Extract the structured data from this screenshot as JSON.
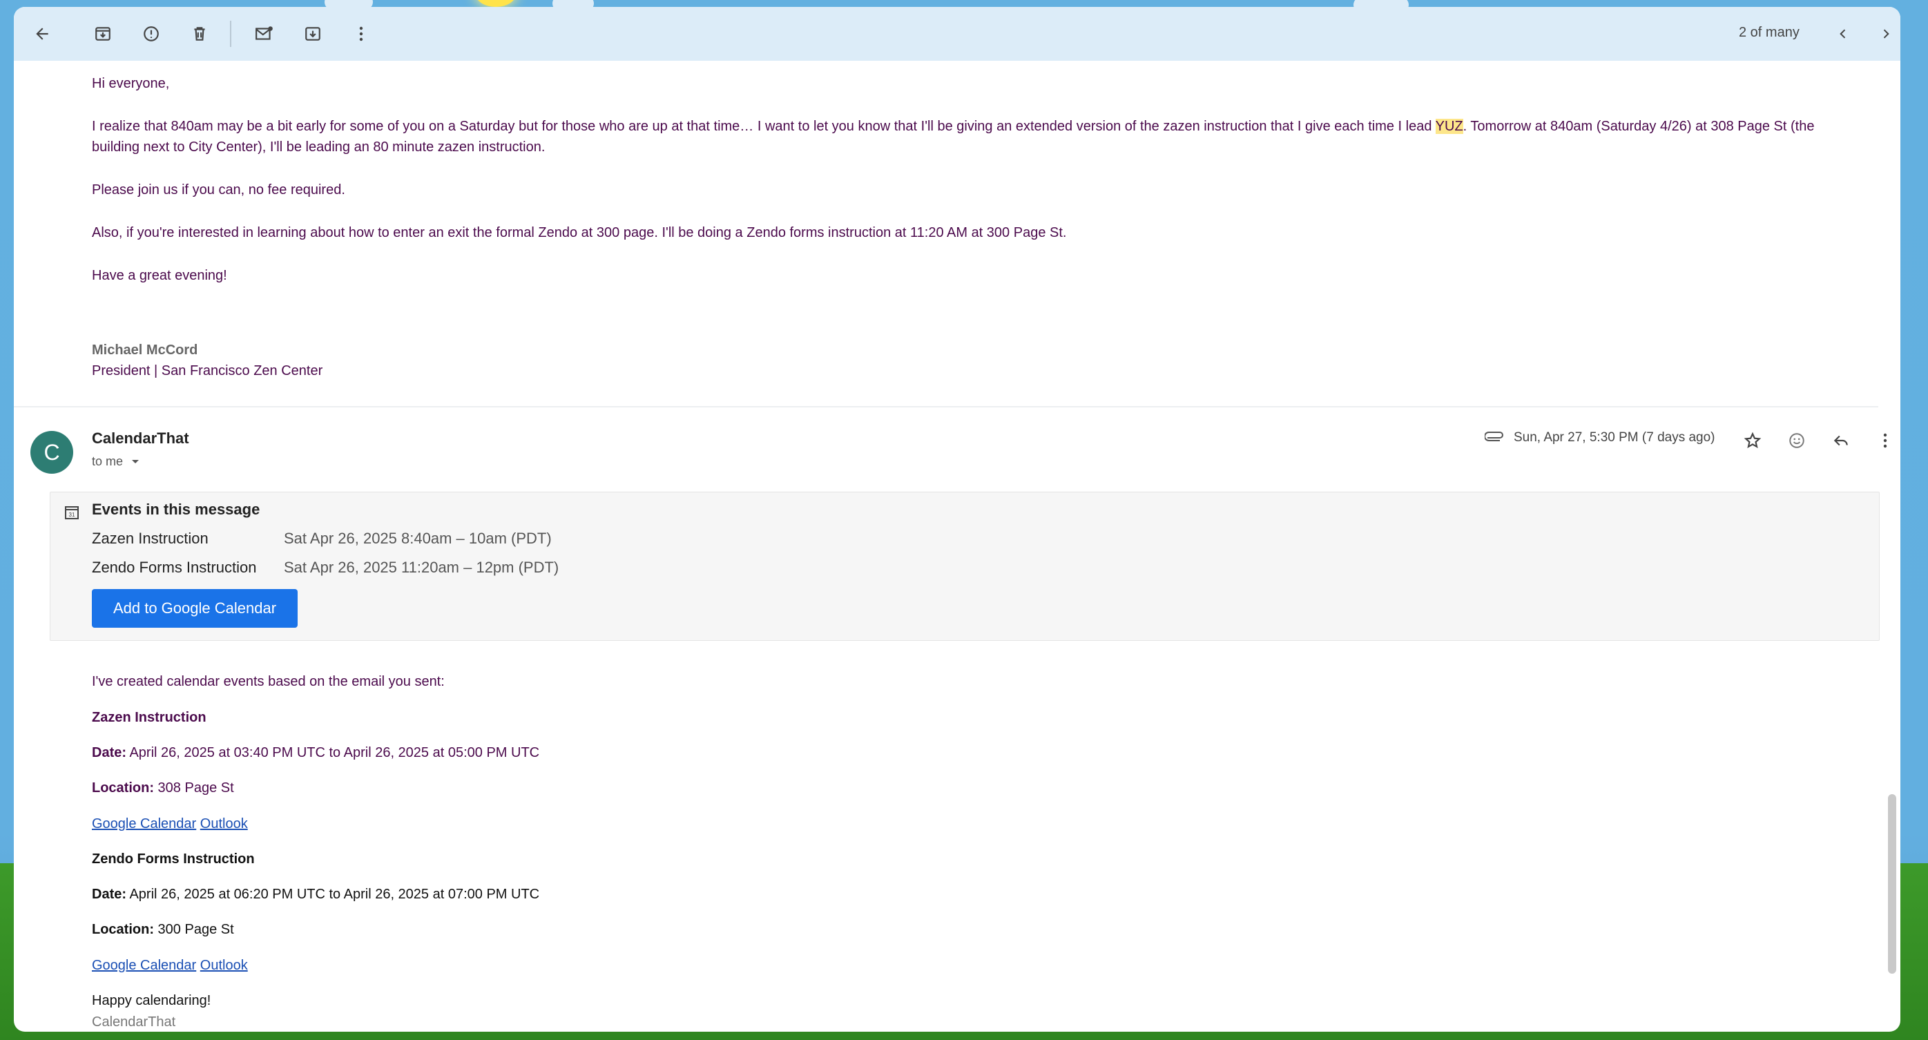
{
  "toolbar": {
    "pager": "2 of many"
  },
  "message1": {
    "greeting": "Hi everyone,",
    "para1_part1": "I realize that 840am may be a bit early for some of you on a Saturday but for those who are up at that time… I want to let you know that I'll be giving an extended version of the zazen instruction that I give each time I lead ",
    "para1_highlight": "YUZ",
    "para1_part2": ". Tomorrow at 840am (Saturday 4/26) at 308 Page St (the",
    "para1_line2": "building next to City Center), I'll be leading an 80 minute zazen instruction.",
    "para2": "Please join us if you can, no fee required.",
    "para3": "Also, if you're interested in learning about how to enter an exit the formal Zendo at 300 page. I'll be doing a Zendo forms instruction at 11:20 AM at 300 Page St.",
    "para4": "Have a great evening!",
    "signature_name": "Michael McCord",
    "signature_title": "President | San Francisco Zen Center"
  },
  "message2": {
    "avatar_letter": "C",
    "sender": "CalendarThat",
    "to": "to me",
    "date": "Sun, Apr 27, 5:30 PM (7 days ago)",
    "events_title": "Events in this message",
    "events": [
      {
        "name": "Zazen Instruction",
        "time": "Sat Apr 26, 2025 8:40am – 10am (PDT)"
      },
      {
        "name": "Zendo Forms Instruction",
        "time": "Sat Apr 26, 2025 11:20am – 12pm (PDT)"
      }
    ],
    "add_button": "Add to Google Calendar",
    "intro": "I've created calendar events based on the email you sent:",
    "e1_title": "Zazen Instruction",
    "e1_date_label": "Date:",
    "e1_date": " April 26, 2025 at 03:40 PM UTC to April 26, 2025 at 05:00 PM UTC",
    "e1_loc_label": "Location:",
    "e1_loc": " 308 Page St",
    "e2_title": "Zendo Forms Instruction",
    "e2_date_label": "Date:",
    "e2_date": " April 26, 2025 at 06:20 PM UTC to April 26, 2025 at 07:00 PM UTC",
    "e2_loc_label": "Location:",
    "e2_loc": " 300 Page St",
    "link_google": "Google Calendar",
    "link_outlook": "Outlook",
    "closing": "Happy calendaring!",
    "closing_sig": "CalendarThat"
  },
  "icons": [
    "back-arrow-icon",
    "archive-icon",
    "report-spam-icon",
    "delete-icon",
    "mark-unread-icon",
    "move-to-icon",
    "more-vert-icon",
    "chevron-left-icon",
    "chevron-right-icon",
    "attachment-icon",
    "star-icon",
    "emoji-icon",
    "reply-icon",
    "calendar-icon",
    "dropdown-icon"
  ]
}
